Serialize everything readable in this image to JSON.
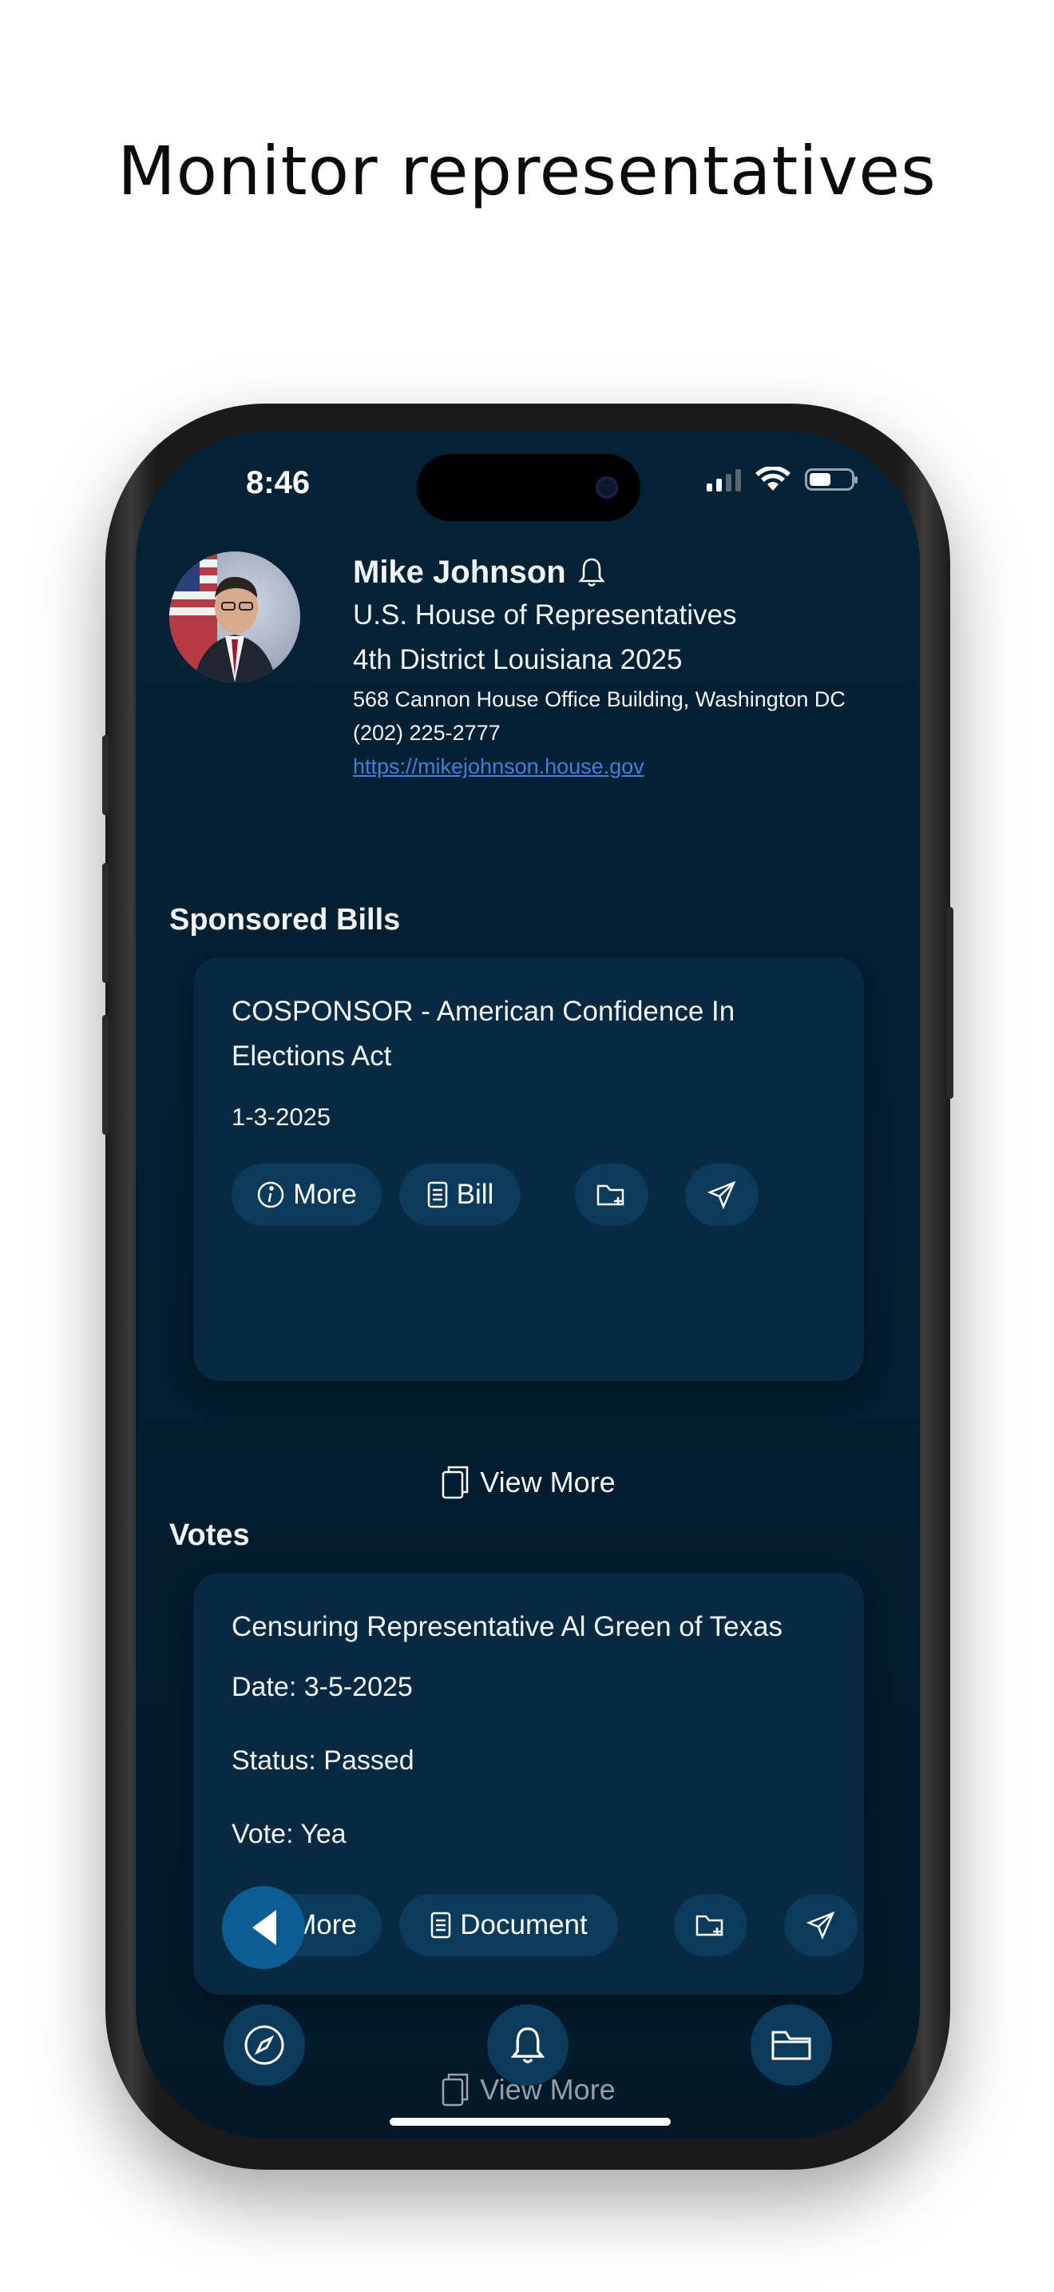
{
  "hero": {
    "title": "Monitor representatives"
  },
  "status_bar": {
    "time": "8:46"
  },
  "profile": {
    "name": "Mike Johnson",
    "chamber": "U.S. House of Representatives",
    "district": "4th District Louisiana 2025",
    "address": "568 Cannon House Office Building, Washington DC",
    "phone": "(202) 225-2777",
    "website": "https://mikejohnson.house.gov"
  },
  "sponsored_bills": {
    "section_title": "Sponsored Bills",
    "card": {
      "title": "COSPONSOR - American Confidence In Elections Act",
      "date": "1-3-2025",
      "more_label": "More",
      "bill_label": "Bill"
    },
    "view_more_label": "View More"
  },
  "votes": {
    "section_title": "Votes",
    "card": {
      "title": "Censuring Representative Al Green of Texas",
      "date": "Date: 3-5-2025",
      "status": "Status: Passed",
      "vote": "Vote: Yea",
      "more_label": "More",
      "document_label": "Document"
    },
    "view_more_label": "View More"
  },
  "icons": {
    "bell": "bell-icon",
    "info": "info-icon",
    "document": "document-icon",
    "folder_add": "folder-add-icon",
    "send": "send-icon",
    "copy": "copy-icon",
    "compass": "compass-icon",
    "folder": "folder-icon",
    "back": "triangle-left-icon"
  },
  "colors": {
    "screen_bg": "#042237",
    "card_bg": "#072a42",
    "pill_bg": "#0b3a5a",
    "back_button": "#0a5e93",
    "link": "#3f7fe0"
  }
}
